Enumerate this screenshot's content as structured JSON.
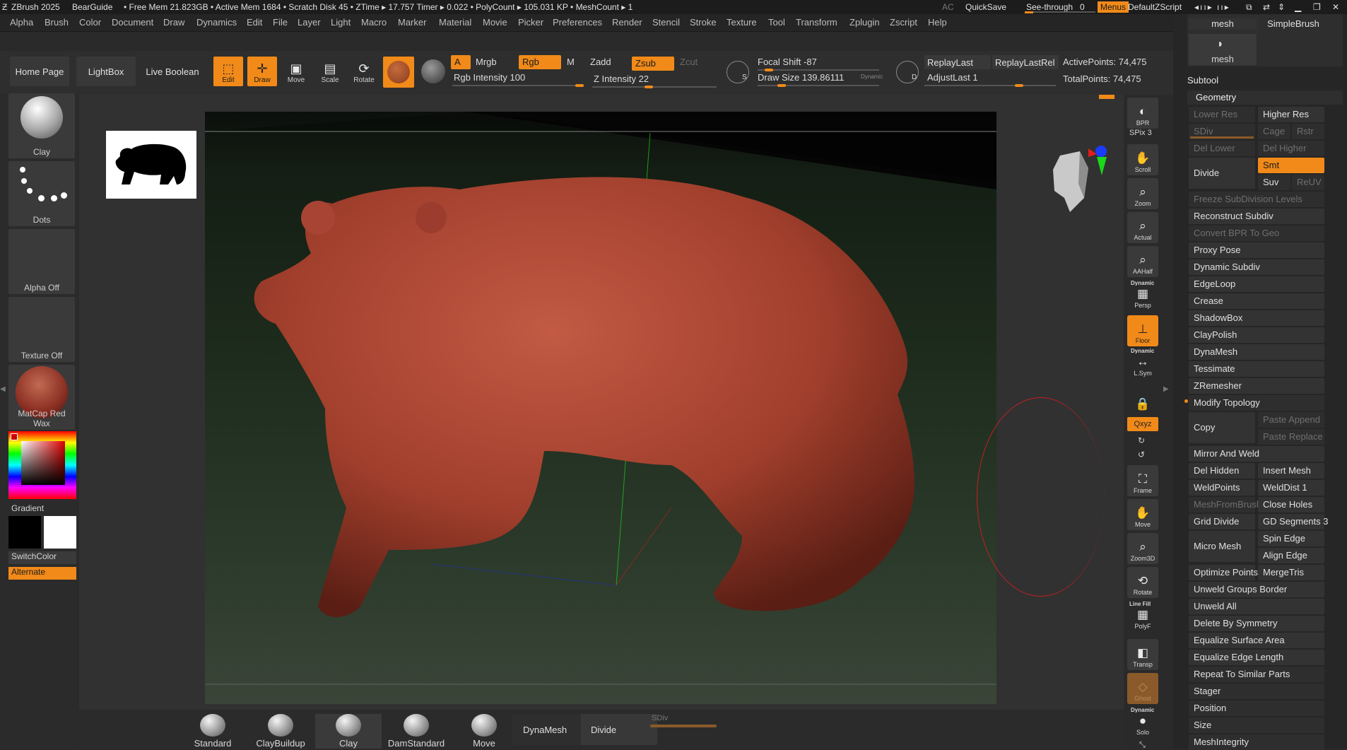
{
  "titlebar": {
    "app": "ZBrush 2025",
    "project": "BearGuide",
    "stats": "• Free Mem 21.823GB • Active Mem 1684 • Scratch Disk 45 • ZTime ▸ 17.757 Timer ▸ 0.022 • PolyCount ▸ 105.031 KP • MeshCount ▸ 1",
    "ac": "AC",
    "quicksave": "QuickSave",
    "seethrough": "See-through",
    "seethrough_value": "0",
    "menus": "Menus",
    "zscript": "DefaultZScript"
  },
  "menu": [
    "Alpha",
    "Brush",
    "Color",
    "Document",
    "Draw",
    "Dynamics",
    "Edit",
    "File",
    "Layer",
    "Light",
    "Macro",
    "Marker",
    "Material",
    "Movie",
    "Picker",
    "Preferences",
    "Render",
    "Stencil",
    "Stroke",
    "Texture",
    "Tool",
    "Transform",
    "Zplugin",
    "Zscript",
    "Help"
  ],
  "shelf": {
    "home": "Home Page",
    "lightbox": "LightBox",
    "liveboolean": "Live Boolean",
    "edit": "Edit",
    "draw": "Draw",
    "move": "Move",
    "scale": "Scale",
    "rotate": "Rotate",
    "a": "A",
    "mrgb": "Mrgb",
    "rgb": "Rgb",
    "m": "M",
    "zadd": "Zadd",
    "zsub": "Zsub",
    "zcut": "Zcut",
    "rgb_intensity": "Rgb Intensity 100",
    "z_intensity": "Z Intensity 22",
    "focal_shift": "Focal Shift -87",
    "draw_size": "Draw Size 139.86111",
    "dynamic": "Dynamic",
    "replaylast": "ReplayLast",
    "replaylastrel": "ReplayLastRel",
    "adjustlast": "AdjustLast 1",
    "active_points": "ActivePoints: 74,475",
    "total_points": "TotalPoints: 74,475",
    "s_label": "S",
    "d_label": "D"
  },
  "left": {
    "brush": "Clay",
    "stroke": "Dots",
    "alpha": "Alpha Off",
    "texture": "Texture Off",
    "material": "MatCap Red Wax",
    "gradient": "Gradient",
    "switchcolor": "SwitchColor",
    "alternate": "Alternate"
  },
  "righttools": {
    "bpr": "BPR",
    "spix": "SPix 3",
    "scroll": "Scroll",
    "zoom": "Zoom",
    "actual": "Actual",
    "aahalf": "AAHalf",
    "dynamic": "Dynamic",
    "persp": "Persp",
    "floor": "Floor",
    "lsym": "L.Sym",
    "xyz": "Qxyz",
    "frame": "Frame",
    "move": "Move",
    "zoom3d": "Zoom3D",
    "rotate": "Rotate",
    "linefill": "Line Fill",
    "polyf": "PolyF",
    "transp": "Transp",
    "ghost": "Ghost",
    "solo": "Solo"
  },
  "rpanel": {
    "mesh1": "mesh",
    "simplebrush": "SimpleBrush",
    "mesh2": "mesh",
    "subtool": "Subtool",
    "geometry": "Geometry",
    "lower_res": "Lower Res",
    "higher_res": "Higher Res",
    "sdiv": "SDiv",
    "cage": "Cage",
    "rstr": "Rstr",
    "del_lower": "Del Lower",
    "del_higher": "Del Higher",
    "divide": "Divide",
    "smt": "Smt",
    "suv": "Suv",
    "reuv": "ReUV",
    "freeze": "Freeze SubDivision Levels",
    "reconstruct": "Reconstruct Subdiv",
    "convert_bpr": "Convert BPR To Geo",
    "proxy_pose": "Proxy Pose",
    "dynamic_subdiv": "Dynamic Subdiv",
    "edgeloop": "EdgeLoop",
    "crease": "Crease",
    "shadowbox": "ShadowBox",
    "claypolish": "ClayPolish",
    "dynamesh": "DynaMesh",
    "tessimate": "Tessimate",
    "zremesher": "ZRemesher",
    "modify_topology": "Modify Topology",
    "copy": "Copy",
    "paste_append": "Paste Append",
    "paste_replace": "Paste Replace",
    "mirror_weld": "Mirror And Weld",
    "del_hidden": "Del Hidden",
    "insert_mesh": "Insert Mesh",
    "weldpoints": "WeldPoints",
    "welddist": "WeldDist 1",
    "meshfrombrush": "MeshFromBrush",
    "close_holes": "Close Holes",
    "grid_divide": "Grid Divide",
    "gd_segments": "GD Segments 3",
    "micro_mesh": "Micro Mesh",
    "spin_edge": "Spin Edge",
    "align_edge": "Align Edge",
    "optimize_points": "Optimize Points",
    "mergetris": "MergeTris",
    "unweld_groups": "Unweld Groups Border",
    "unweld_all": "Unweld All",
    "delete_symmetry": "Delete By Symmetry",
    "equalize_surface": "Equalize Surface Area",
    "equalize_edge": "Equalize Edge Length",
    "repeat_similar": "Repeat To Similar Parts",
    "stager": "Stager",
    "position": "Position",
    "size": "Size",
    "meshintegrity": "MeshIntegrity"
  },
  "bottom": {
    "standard": "Standard",
    "claybuildup": "ClayBuildup",
    "clay": "Clay",
    "damstandard": "DamStandard",
    "move": "Move",
    "dynamesh": "DynaMesh",
    "divide": "Divide",
    "sdiv": "SDiv"
  },
  "colors": {
    "accent": "#f18a19",
    "model": "#a8412f",
    "brush_ring": "#c02020"
  }
}
